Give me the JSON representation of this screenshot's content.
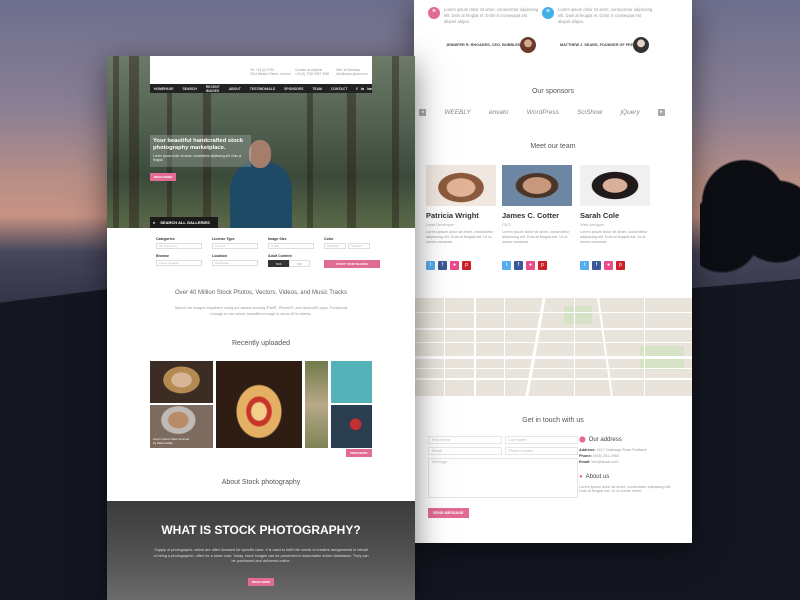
{
  "back_page": {
    "testimonials": [
      {
        "text": "Lorem ipsum dolor sit amet, consectetur adipiscing elit. Duis at feugiat et. Dolor in consequat est aliquet aliqua.",
        "author": "JENNIFER R. RHOADES, CEO, BUBBLESPHERE"
      },
      {
        "text": "Lorem ipsum dolor sit amet, consectetur adipiscing elit. Duis at feugiat et. Dolor in consequat est aliquet aliqua.",
        "author": "MATTHEW J. SEARS, FOUNDER OF FEEDCLUB"
      }
    ],
    "sponsors_title": "Our sponsors",
    "sponsors": [
      "WEEBLY",
      "envato",
      "WordPress",
      "SciShow",
      "jQuery"
    ],
    "team_title": "Meet our team",
    "team": [
      {
        "name": "Patricia Wright",
        "role": "Lead Developer",
        "desc": "Lorem ipsum dolor sit amet, consectetur adipiscing elit. Duis at feugiat est. Ut ut omnis consecte."
      },
      {
        "name": "James C. Cotter",
        "role": "CEO",
        "desc": "Lorem ipsum dolor sit amet, consectetur adipiscing elit. Duis at feugiat est. Ut ut omnis consecte."
      },
      {
        "name": "Sarah Cole",
        "role": "Web designer",
        "desc": "Lorem ipsum dolor sit amet, consectetur adipiscing elit. Duis at feugiat est. Ut ut omnis consecte."
      }
    ],
    "contact_title": "Get in touch with us",
    "form": {
      "first_name": "First name",
      "last_name": "Last name",
      "email": "Email",
      "phone": "Phone number",
      "message": "Message",
      "send": "SEND MESSAGE"
    },
    "address": {
      "title": "Our address",
      "address_label": "Address:",
      "address_value": "1617 Gateway Road Portland",
      "phone_label": "Phone:",
      "phone_value": "(503) 261-2964",
      "email_label": "Email:",
      "email_value": "info@stock.com"
    },
    "about_us": {
      "title": "About us",
      "text": "Lorem ipsum dolor sit amet, consectetur adipiscing elit. Duis at feugiat est. Ut ut omnis lorem."
    }
  },
  "front_page": {
    "header_info": [
      "Tel: +44 (0) 0750\n3764 Weston Street, London",
      "Contact us anytime\n+44 (0) 7760 3567 4059",
      "Mail: at Mondays\ninfo@stock.photo.com"
    ],
    "nav": [
      "HOMEPAGE",
      "SEARCH",
      "RECENT IMAGES",
      "ABOUT",
      "TESTIMONIALS",
      "SPONSORS",
      "TEAM",
      "CONTACT"
    ],
    "nav_social": [
      "f",
      "in",
      "be"
    ],
    "hero": {
      "heading": "Your beautiful handcrafted stock photography marketplace.",
      "text": "Lorem ipsum dolor sit amet, consectetur adipiscing elit. Duis at feugiat.",
      "button": "READ MORE"
    },
    "search_label": "SEARCH ALL GALLERIES",
    "filters": {
      "category": {
        "label": "Categories",
        "value": "All categories"
      },
      "license": {
        "label": "License Type",
        "value": "License"
      },
      "size": {
        "label": "Image Size",
        "value": "Small"
      },
      "color": {
        "label": "Color",
        "value": "#000000",
        "button": "SELECT"
      },
      "browse": {
        "label": "Browse",
        "value": "Latest uploads"
      },
      "location": {
        "label": "Location",
        "value": "Worldwide"
      },
      "adult": {
        "label": "Adult Content",
        "yes": "YES",
        "no": "NO"
      },
      "start_button": "START YOUR SEARCH"
    },
    "million_heading": "Over 40 Million Stock Photos, Vectors, Videos, and Music Tracks",
    "million_text": "Search for images anywhere using our award-winning iPad®, iPhone®, and Android® apps. Functional enough to use alone, beautiful enough to show off to clients.",
    "recent_title": "Recently uploaded",
    "gallery_caption": "Lorem ipsum dolor sit amet\nby Mark Fields",
    "view_more": "VIEW MORE",
    "about_title": "About Stock photography",
    "what": {
      "heading": "WHAT IS STOCK PHOTOGRAPHY?",
      "text": "Supply of photographs, which are often licensed for specific uses. It is used to fulfill the needs of creative assignments in behalf of hiring a photographer, often for a lower cost. Today, stock images can be presented in searchable online databases. They can be purchased and delivered online.",
      "button": "READ MORE"
    }
  },
  "colors": {
    "accent": "#e26b96",
    "quote_blue": "#43b0e8",
    "twitter": "#55acee",
    "facebook": "#3b5998",
    "dribbble": "#ea4c89",
    "pinterest": "#cb2027"
  },
  "icons": {
    "quote": "quote-icon",
    "pin": "map-pin-icon",
    "user": "user-icon",
    "search": "search-icon"
  }
}
